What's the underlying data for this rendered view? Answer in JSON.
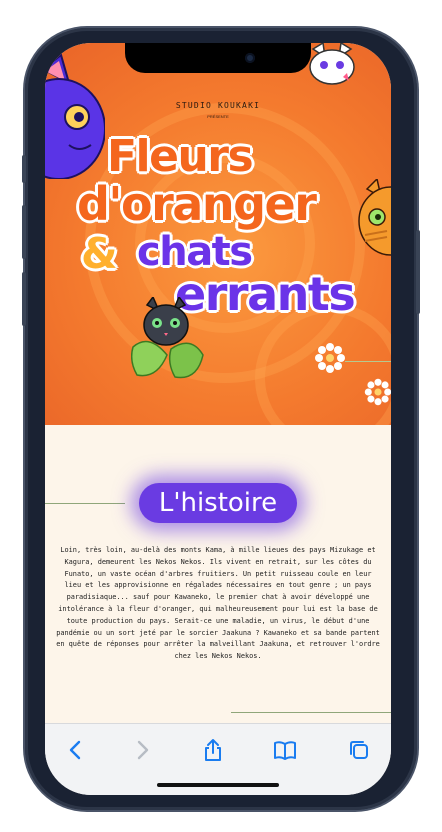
{
  "hero": {
    "studio": "STUDIO KOUKAKI",
    "presente": "PRÉSENTE",
    "title_line1": "Fleurs",
    "title_line2": "d'oranger",
    "title_amp": "&",
    "title_line3": "chats",
    "title_line4": "errants"
  },
  "story": {
    "heading": "L'histoire",
    "paragraph": "Loin, très loin, au-delà des monts Kama, à mille lieues des pays Mizukage et Kagura, demeurent les Nekos Nekos. Ils vivent en retrait, sur les côtes du Funato, un vaste océan d'arbres fruitiers. Un petit ruisseau coule en leur lieu et les approvisionne en régalades nécessaires en tout genre ; un pays paradisiaque... sauf pour Kawaneko, le premier chat à avoir développé une intolérance à la fleur d'oranger, qui malheureusement pour lui est la base de toute production du pays. Serait-ce une maladie, un virus, le début d'une pandémie ou un sort jeté par le sorcier Jaakuna ? Kawaneko et sa bande partent en quête de réponses pour arrêter la malveillant Jaakuna, et retrouver l'ordre chez les Nekos Nekos."
  },
  "toolbar": {
    "icons": [
      "back-icon",
      "forward-icon",
      "share-icon",
      "bookmarks-icon",
      "tabs-icon"
    ]
  },
  "colors": {
    "hero_orange": "#f47a2e",
    "title_orange": "#f4661d",
    "title_purple": "#6b33e8",
    "amp_yellow": "#ffb02e",
    "heading_bg": "#6a3be2",
    "ios_blue": "#1a7cf0",
    "page_bg": "#fdf5ea"
  }
}
